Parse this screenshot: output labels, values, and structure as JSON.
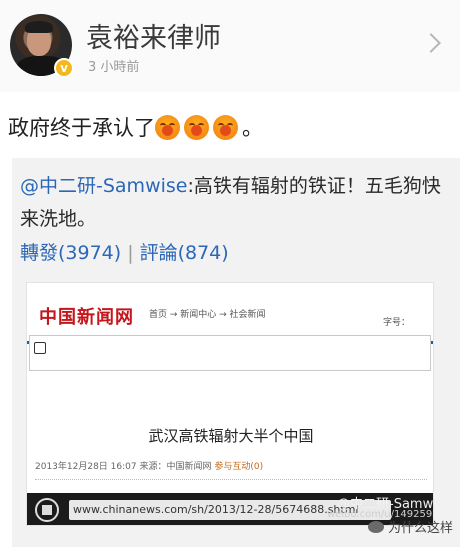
{
  "header": {
    "author_name": "袁裕来律师",
    "timestamp": "3 小時前",
    "verified_mark": "v"
  },
  "post": {
    "text": "政府终于承认了",
    "end_punct": "。",
    "emoji_icon": "laughing-tears-icon"
  },
  "repost": {
    "user": "@中二研-Samwise",
    "text": ":高铁有辐射的铁证！五毛狗快来洗地。",
    "reposts_label": "轉發(3974)",
    "separator": "|",
    "comments_label": "評論(874)"
  },
  "news_screenshot": {
    "logo": "中国新闻网",
    "breadcrumb": "首页 → 新闻中心 → 社会新闻",
    "field_label": "字号：",
    "headline": "武汉高铁辐射大半个中国",
    "date": "2013年12月28日 16:07",
    "source": "来源：中国新闻网",
    "feedback": "参与互动(0)",
    "url": "www.chinanews.com/sh/2013/12-28/5674688.shtml",
    "watermark_user": "@中二研-Samwise",
    "watermark_url": "weibo.com/u/1492592775"
  },
  "footer": {
    "wechat_label": "为什么这样"
  },
  "colors": {
    "link_blue": "#2b67b6",
    "news_red": "#c4161c",
    "news_bar": "#1c5ea8",
    "verified_gold": "#f2b81c"
  }
}
